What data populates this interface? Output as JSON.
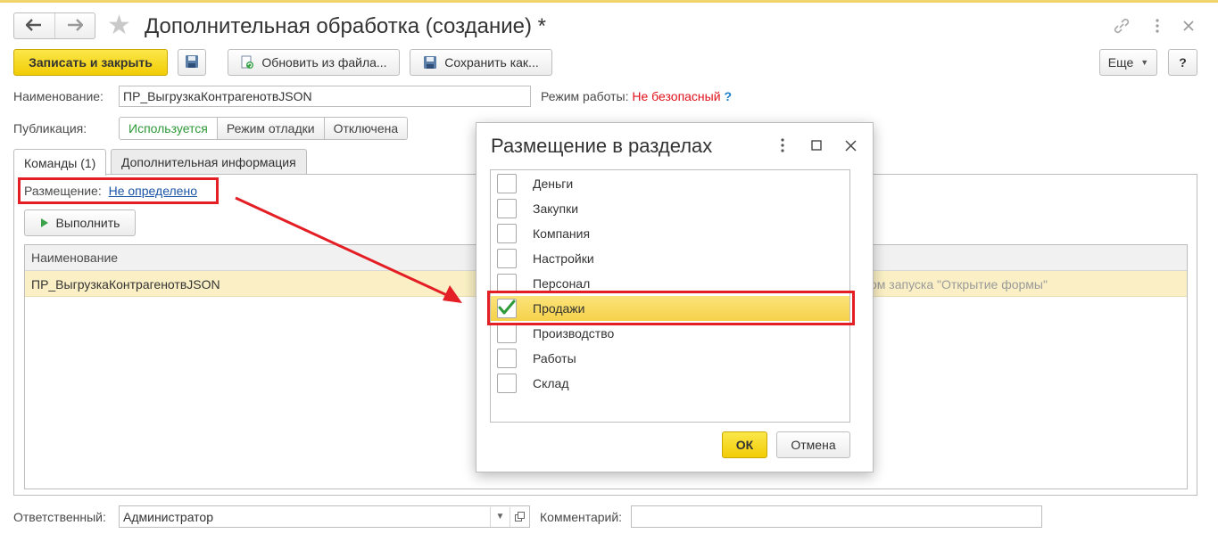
{
  "window": {
    "title": "Дополнительная обработка (создание) *"
  },
  "toolbar": {
    "save_close_label": "Записать и закрыть",
    "update_from_file_label": "Обновить из файла...",
    "save_as_label": "Сохранить как...",
    "more_label": "Еще",
    "help_label": "?"
  },
  "form": {
    "name_label": "Наименование:",
    "name_value": "ПР_ВыгрузкаКонтрагенотвJSON",
    "mode_label": "Режим работы:",
    "mode_value": "Не безопасный",
    "mode_help": "?",
    "publication_label": "Публикация:",
    "publication_options": [
      "Используется",
      "Режим отладки",
      "Отключена"
    ],
    "publication_selected": "Используется"
  },
  "tabs": [
    {
      "label": "Команды (1)",
      "active": true
    },
    {
      "label": "Дополнительная информация",
      "active": false
    }
  ],
  "commands": {
    "placement_label": "Размещение:",
    "placement_value": "Не определено",
    "execute_label": "Выполнить",
    "column_header": "Наименование",
    "row_name": "ПР_ВыгрузкаКонтрагенотвJSON",
    "row_partial_text": "ом запуска \"Открытие формы\""
  },
  "footer": {
    "responsible_label": "Ответственный:",
    "responsible_value": "Администратор",
    "comment_label": "Комментарий:",
    "comment_value": ""
  },
  "dialog": {
    "title": "Размещение в разделах",
    "items": [
      {
        "label": "Деньги",
        "checked": false
      },
      {
        "label": "Закупки",
        "checked": false
      },
      {
        "label": "Компания",
        "checked": false
      },
      {
        "label": "Настройки",
        "checked": false
      },
      {
        "label": "Персонал",
        "checked": false
      },
      {
        "label": "Продажи",
        "checked": true
      },
      {
        "label": "Производство",
        "checked": false
      },
      {
        "label": "Работы",
        "checked": false
      },
      {
        "label": "Склад",
        "checked": false
      }
    ],
    "ok_label": "ОК",
    "cancel_label": "Отмена"
  },
  "colors": {
    "primary_button": "#f7d81c",
    "danger_text": "#e0111a",
    "highlight_frame": "#e31e24",
    "link": "#1a55a6",
    "active_option": "#2e9a38",
    "selected_row": "#fbf0c5"
  }
}
